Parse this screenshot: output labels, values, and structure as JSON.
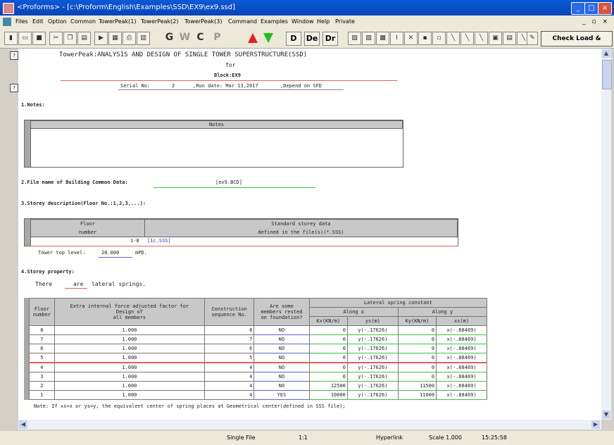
{
  "window": {
    "title": "<Proforms> - [c:\\Proform\\English\\Examples\\SSD\\EX9\\ex9.ssd]",
    "minimize": "_",
    "maximize": "□",
    "close": "×"
  },
  "menu": {
    "items": [
      "Files",
      "Edit",
      "Option",
      "Common",
      "TowerPeak(1)",
      "TowerPeak(2)",
      "TowerPeak(3)",
      "Command",
      "Examples",
      "Window",
      "Help",
      "Private"
    ],
    "mdi_controls": "_ ▫ ×"
  },
  "toolbar": {
    "letters": {
      "g": "G",
      "w": "W",
      "c": "C",
      "p": "P"
    },
    "d_buttons": {
      "d": "D",
      "de": "De",
      "dr": "Dr"
    },
    "check_button": "Check Load & Result"
  },
  "gutter": {
    "marker1": "?",
    "marker2": "?"
  },
  "document": {
    "title": "TowerPeak:ANALYSIS AND DESIGN OF SINGLE TOWER SUPERSTRUCTURE(SSD)",
    "for_label": "for",
    "block": "Block:EX9",
    "serial_label": "Serial No:",
    "serial_value": "2",
    "run_date": ",Run date: Mar 13,2017",
    "depend": ",Depend on  SFD",
    "notes_heading": "1.Notes:",
    "notes_header": "Notes",
    "file_heading": "2.File name of Building Common Data:",
    "file_value": "[ex9.BCD]",
    "storey_desc_heading": "3.Storey description(Floor No.:1,2,3,...):",
    "storey_desc_col1_line1": "Floor",
    "storey_desc_col1_line2": "number",
    "storey_desc_col2_line1": "Standard storey data",
    "storey_desc_col2_line2": "defined in the file(s)(*.SSS)",
    "storey_desc_row_floor": "1-8",
    "storey_desc_row_file": "[1c.SSS]",
    "tower_top_label": "Tower top level:",
    "tower_top_value": "20.000",
    "tower_top_unit": "mPD.",
    "storey_prop_heading": "4.Storey property:",
    "springs_pre": "There",
    "springs_value": "are",
    "springs_post": "lateral springs.",
    "note": "Note: If xs=x or ys=y, the equivalent center of spring places at Geometrical center(defined in SSS file);"
  },
  "spring_table": {
    "headers": {
      "floor_1": "Floor",
      "floor_2": "number",
      "factor_1": "Extra internal force adjusted factor for",
      "factor_2": "Design of",
      "factor_3": "all members",
      "seq_1": "Construction",
      "seq_2": "sequence No.",
      "found_1": "Are some",
      "found_2": "members rested",
      "found_3": "on foundation?",
      "lateral": "Lateral spring constant",
      "along_x": "Along x",
      "along_y": "Along y",
      "kx": "Kx(KN/m)",
      "ys": "ys(m)",
      "ky": "Ky(KN/m)",
      "xs": "xs(m)"
    },
    "rows": [
      {
        "floor": "8",
        "factor": "1.000",
        "seq": "8",
        "found": "NO",
        "kx": "0",
        "ys": "y(-.17626)",
        "ky": "0",
        "xs": "x(-.88469)"
      },
      {
        "floor": "7",
        "factor": "1.000",
        "seq": "7",
        "found": "NO",
        "kx": "0",
        "ys": "y(-.17626)",
        "ky": "0",
        "xs": "x(-.88469)"
      },
      {
        "floor": "6",
        "factor": "1.000",
        "seq": "6",
        "found": "NO",
        "kx": "0",
        "ys": "y(-.17626)",
        "ky": "0",
        "xs": "x(-.88469)"
      },
      {
        "floor": "5",
        "factor": "1.000",
        "seq": "5",
        "found": "NO",
        "kx": "0",
        "ys": "y(-.17626)",
        "ky": "0",
        "xs": "x(-.88469)"
      },
      {
        "floor": "4",
        "factor": "1.000",
        "seq": "4",
        "found": "NO",
        "kx": "0",
        "ys": "y(-.17626)",
        "ky": "0",
        "xs": "x(-.88469)"
      },
      {
        "floor": "3",
        "factor": "1.000",
        "seq": "4",
        "found": "NO",
        "kx": "0",
        "ys": "y(-.17626)",
        "ky": "0",
        "xs": "x(-.88469)"
      },
      {
        "floor": "2",
        "factor": "1.000",
        "seq": "4",
        "found": "NO",
        "kx": "12500",
        "ys": "y(-.17626)",
        "ky": "11500",
        "xs": "x(-.88469)"
      },
      {
        "floor": "1",
        "factor": "1.000",
        "seq": "4",
        "found": "YES",
        "kx": "10000",
        "ys": "y(-.17626)",
        "ky": "11000",
        "xs": "x(-.88469)"
      }
    ]
  },
  "status": {
    "mode": "Single File",
    "position": "1:1",
    "hyperlink": "Hyperlink",
    "scale": "Scale  1.000",
    "time": "15:25:58"
  },
  "colors": {
    "title_red_line": "#e06060",
    "green_underline": "#40c040",
    "blue_underline": "#6060d0",
    "header_gray": "#c8c8c8"
  }
}
